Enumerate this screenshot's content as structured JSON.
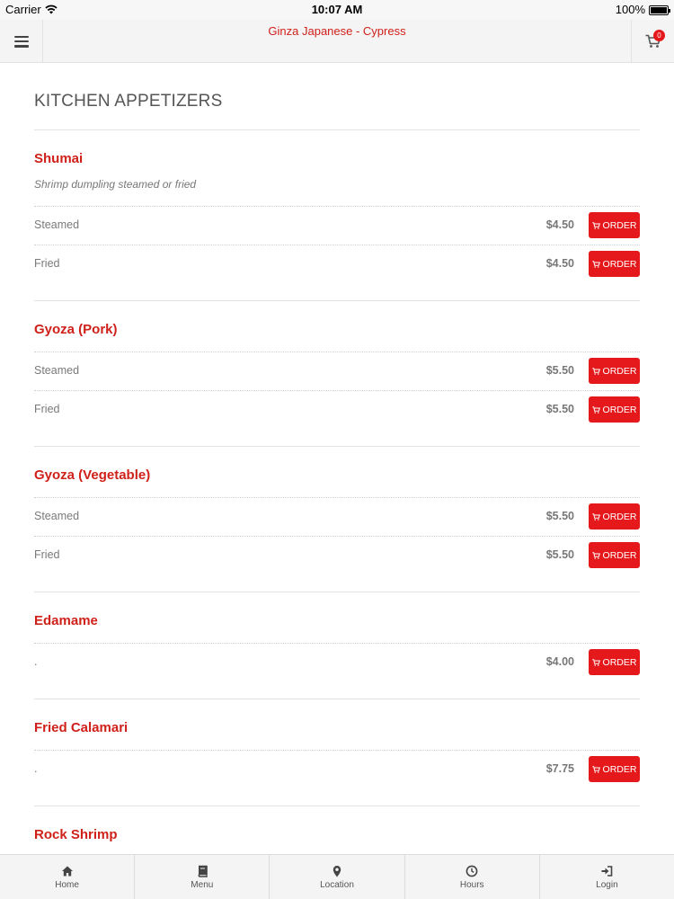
{
  "status_bar": {
    "carrier": "Carrier",
    "time": "10:07 AM",
    "battery": "100%"
  },
  "header": {
    "title": "Ginza Japanese - Cypress",
    "cart_count": "0"
  },
  "section": {
    "title": "KITCHEN APPETIZERS"
  },
  "items": [
    {
      "name": "Shumai",
      "description": "Shrimp dumpling steamed or fried",
      "options": [
        {
          "label": "Steamed",
          "price": "$4.50",
          "button": "ORDER"
        },
        {
          "label": "Fried",
          "price": "$4.50",
          "button": "ORDER"
        }
      ]
    },
    {
      "name": "Gyoza (Pork)",
      "options": [
        {
          "label": "Steamed",
          "price": "$5.50",
          "button": "ORDER"
        },
        {
          "label": "Fried",
          "price": "$5.50",
          "button": "ORDER"
        }
      ]
    },
    {
      "name": "Gyoza (Vegetable)",
      "options": [
        {
          "label": "Steamed",
          "price": "$5.50",
          "button": "ORDER"
        },
        {
          "label": "Fried",
          "price": "$5.50",
          "button": "ORDER"
        }
      ]
    },
    {
      "name": "Edamame",
      "options": [
        {
          "label": ".",
          "price": "$4.00",
          "button": "ORDER"
        }
      ]
    },
    {
      "name": "Fried Calamari",
      "options": [
        {
          "label": ".",
          "price": "$7.75",
          "button": "ORDER"
        }
      ]
    },
    {
      "name": "Rock Shrimp"
    }
  ],
  "tab_bar": [
    {
      "label": "Home",
      "icon": "home-icon"
    },
    {
      "label": "Menu",
      "icon": "book-icon"
    },
    {
      "label": "Location",
      "icon": "map-pin-icon"
    },
    {
      "label": "Hours",
      "icon": "clock-icon"
    },
    {
      "label": "Login",
      "icon": "sign-in-icon"
    }
  ],
  "colors": {
    "accent": "#e5191c",
    "item_name": "#d0201a"
  }
}
